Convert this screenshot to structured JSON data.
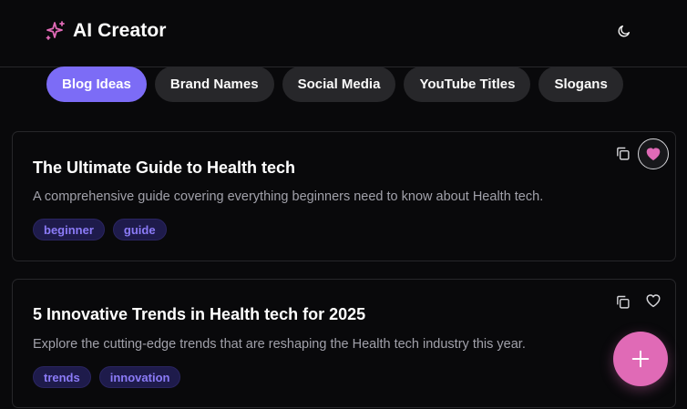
{
  "header": {
    "title": "AI Creator",
    "logo_icon": "sparkles-icon",
    "theme_icon": "moon-icon"
  },
  "tabs": [
    {
      "label": "Blog Ideas",
      "active": true
    },
    {
      "label": "Brand Names",
      "active": false
    },
    {
      "label": "Social Media",
      "active": false
    },
    {
      "label": "YouTube Titles",
      "active": false
    },
    {
      "label": "Slogans",
      "active": false
    }
  ],
  "cards": [
    {
      "title": "The Ultimate Guide to Health tech",
      "description": "A comprehensive guide covering everything beginners need to know about Health tech.",
      "tags": [
        "beginner",
        "guide"
      ],
      "favorited": true
    },
    {
      "title": "5 Innovative Trends in Health tech for 2025",
      "description": "Explore the cutting-edge trends that are reshaping the Health tech industry this year.",
      "tags": [
        "trends",
        "innovation"
      ],
      "favorited": false
    }
  ],
  "colors": {
    "accent": "#7c6cf6",
    "pink": "#e06ab6",
    "background": "#09090b",
    "tag_text": "#8b7bf7"
  }
}
